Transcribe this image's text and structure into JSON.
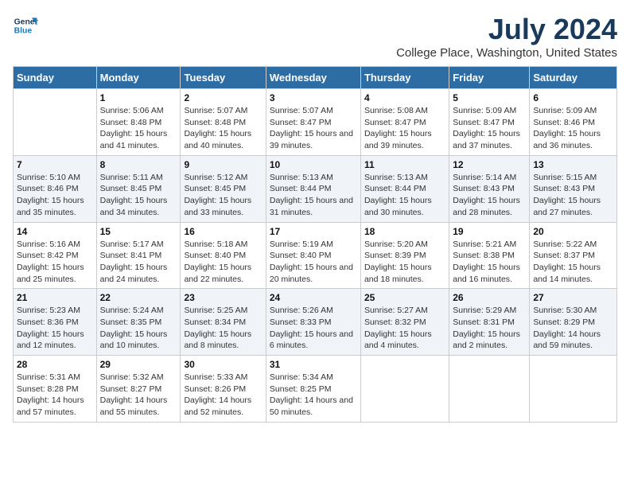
{
  "header": {
    "logo_line1": "General",
    "logo_line2": "Blue",
    "title": "July 2024",
    "subtitle": "College Place, Washington, United States"
  },
  "weekdays": [
    "Sunday",
    "Monday",
    "Tuesday",
    "Wednesday",
    "Thursday",
    "Friday",
    "Saturday"
  ],
  "weeks": [
    [
      {
        "day": "",
        "sunrise": "",
        "sunset": "",
        "daylight": ""
      },
      {
        "day": "1",
        "sunrise": "Sunrise: 5:06 AM",
        "sunset": "Sunset: 8:48 PM",
        "daylight": "Daylight: 15 hours and 41 minutes."
      },
      {
        "day": "2",
        "sunrise": "Sunrise: 5:07 AM",
        "sunset": "Sunset: 8:48 PM",
        "daylight": "Daylight: 15 hours and 40 minutes."
      },
      {
        "day": "3",
        "sunrise": "Sunrise: 5:07 AM",
        "sunset": "Sunset: 8:47 PM",
        "daylight": "Daylight: 15 hours and 39 minutes."
      },
      {
        "day": "4",
        "sunrise": "Sunrise: 5:08 AM",
        "sunset": "Sunset: 8:47 PM",
        "daylight": "Daylight: 15 hours and 39 minutes."
      },
      {
        "day": "5",
        "sunrise": "Sunrise: 5:09 AM",
        "sunset": "Sunset: 8:47 PM",
        "daylight": "Daylight: 15 hours and 37 minutes."
      },
      {
        "day": "6",
        "sunrise": "Sunrise: 5:09 AM",
        "sunset": "Sunset: 8:46 PM",
        "daylight": "Daylight: 15 hours and 36 minutes."
      }
    ],
    [
      {
        "day": "7",
        "sunrise": "Sunrise: 5:10 AM",
        "sunset": "Sunset: 8:46 PM",
        "daylight": "Daylight: 15 hours and 35 minutes."
      },
      {
        "day": "8",
        "sunrise": "Sunrise: 5:11 AM",
        "sunset": "Sunset: 8:45 PM",
        "daylight": "Daylight: 15 hours and 34 minutes."
      },
      {
        "day": "9",
        "sunrise": "Sunrise: 5:12 AM",
        "sunset": "Sunset: 8:45 PM",
        "daylight": "Daylight: 15 hours and 33 minutes."
      },
      {
        "day": "10",
        "sunrise": "Sunrise: 5:13 AM",
        "sunset": "Sunset: 8:44 PM",
        "daylight": "Daylight: 15 hours and 31 minutes."
      },
      {
        "day": "11",
        "sunrise": "Sunrise: 5:13 AM",
        "sunset": "Sunset: 8:44 PM",
        "daylight": "Daylight: 15 hours and 30 minutes."
      },
      {
        "day": "12",
        "sunrise": "Sunrise: 5:14 AM",
        "sunset": "Sunset: 8:43 PM",
        "daylight": "Daylight: 15 hours and 28 minutes."
      },
      {
        "day": "13",
        "sunrise": "Sunrise: 5:15 AM",
        "sunset": "Sunset: 8:43 PM",
        "daylight": "Daylight: 15 hours and 27 minutes."
      }
    ],
    [
      {
        "day": "14",
        "sunrise": "Sunrise: 5:16 AM",
        "sunset": "Sunset: 8:42 PM",
        "daylight": "Daylight: 15 hours and 25 minutes."
      },
      {
        "day": "15",
        "sunrise": "Sunrise: 5:17 AM",
        "sunset": "Sunset: 8:41 PM",
        "daylight": "Daylight: 15 hours and 24 minutes."
      },
      {
        "day": "16",
        "sunrise": "Sunrise: 5:18 AM",
        "sunset": "Sunset: 8:40 PM",
        "daylight": "Daylight: 15 hours and 22 minutes."
      },
      {
        "day": "17",
        "sunrise": "Sunrise: 5:19 AM",
        "sunset": "Sunset: 8:40 PM",
        "daylight": "Daylight: 15 hours and 20 minutes."
      },
      {
        "day": "18",
        "sunrise": "Sunrise: 5:20 AM",
        "sunset": "Sunset: 8:39 PM",
        "daylight": "Daylight: 15 hours and 18 minutes."
      },
      {
        "day": "19",
        "sunrise": "Sunrise: 5:21 AM",
        "sunset": "Sunset: 8:38 PM",
        "daylight": "Daylight: 15 hours and 16 minutes."
      },
      {
        "day": "20",
        "sunrise": "Sunrise: 5:22 AM",
        "sunset": "Sunset: 8:37 PM",
        "daylight": "Daylight: 15 hours and 14 minutes."
      }
    ],
    [
      {
        "day": "21",
        "sunrise": "Sunrise: 5:23 AM",
        "sunset": "Sunset: 8:36 PM",
        "daylight": "Daylight: 15 hours and 12 minutes."
      },
      {
        "day": "22",
        "sunrise": "Sunrise: 5:24 AM",
        "sunset": "Sunset: 8:35 PM",
        "daylight": "Daylight: 15 hours and 10 minutes."
      },
      {
        "day": "23",
        "sunrise": "Sunrise: 5:25 AM",
        "sunset": "Sunset: 8:34 PM",
        "daylight": "Daylight: 15 hours and 8 minutes."
      },
      {
        "day": "24",
        "sunrise": "Sunrise: 5:26 AM",
        "sunset": "Sunset: 8:33 PM",
        "daylight": "Daylight: 15 hours and 6 minutes."
      },
      {
        "day": "25",
        "sunrise": "Sunrise: 5:27 AM",
        "sunset": "Sunset: 8:32 PM",
        "daylight": "Daylight: 15 hours and 4 minutes."
      },
      {
        "day": "26",
        "sunrise": "Sunrise: 5:29 AM",
        "sunset": "Sunset: 8:31 PM",
        "daylight": "Daylight: 15 hours and 2 minutes."
      },
      {
        "day": "27",
        "sunrise": "Sunrise: 5:30 AM",
        "sunset": "Sunset: 8:29 PM",
        "daylight": "Daylight: 14 hours and 59 minutes."
      }
    ],
    [
      {
        "day": "28",
        "sunrise": "Sunrise: 5:31 AM",
        "sunset": "Sunset: 8:28 PM",
        "daylight": "Daylight: 14 hours and 57 minutes."
      },
      {
        "day": "29",
        "sunrise": "Sunrise: 5:32 AM",
        "sunset": "Sunset: 8:27 PM",
        "daylight": "Daylight: 14 hours and 55 minutes."
      },
      {
        "day": "30",
        "sunrise": "Sunrise: 5:33 AM",
        "sunset": "Sunset: 8:26 PM",
        "daylight": "Daylight: 14 hours and 52 minutes."
      },
      {
        "day": "31",
        "sunrise": "Sunrise: 5:34 AM",
        "sunset": "Sunset: 8:25 PM",
        "daylight": "Daylight: 14 hours and 50 minutes."
      },
      {
        "day": "",
        "sunrise": "",
        "sunset": "",
        "daylight": ""
      },
      {
        "day": "",
        "sunrise": "",
        "sunset": "",
        "daylight": ""
      },
      {
        "day": "",
        "sunrise": "",
        "sunset": "",
        "daylight": ""
      }
    ]
  ]
}
